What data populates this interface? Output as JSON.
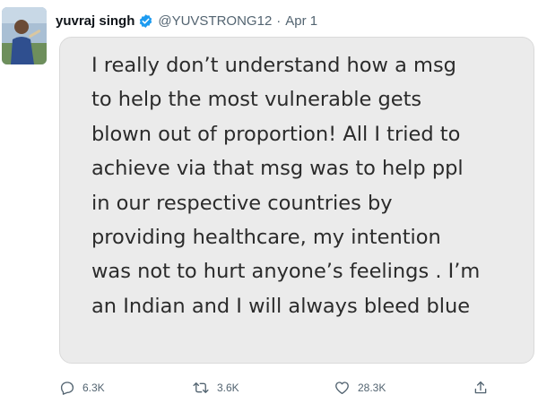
{
  "tweet": {
    "author_name": "yuvraj singh",
    "handle": "@YUVSTRONG12",
    "separator": "·",
    "date": "Apr 1",
    "image_text_lines": [
      "I really don’t understand how a msg",
      "to help the most vulnerable gets",
      "blown out of proportion! All I tried to",
      "achieve via that msg was to help ppl",
      "in our respective countries by",
      "providing healthcare, my intention",
      "was not to hurt anyone’s feelings . I’m",
      "an Indian and I will always bleed blue"
    ],
    "actions": {
      "reply_count": "6.3K",
      "retweet_count": "3.6K",
      "like_count": "28.3K"
    }
  },
  "icons": {
    "verified": "verified-badge-icon",
    "reply": "reply-icon",
    "retweet": "retweet-icon",
    "like": "like-icon",
    "share": "share-icon"
  },
  "colors": {
    "name": "#0f1419",
    "secondary_text": "#536471",
    "verified_badge": "#1d9bf0",
    "image_background": "#ebebeb",
    "image_text": "#2b2b2b"
  }
}
